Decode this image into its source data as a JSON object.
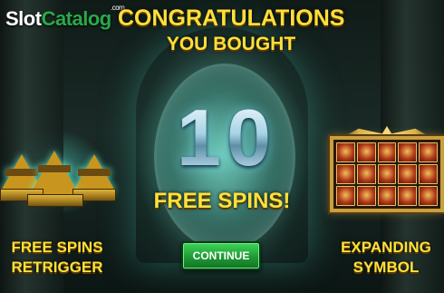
{
  "logo": {
    "slot": "Slot",
    "catalog": "Catalog",
    "com": ".com"
  },
  "headline": {
    "line1": "CONGRATULATIONS",
    "line2": "YOU BOUGHT"
  },
  "award": {
    "count": "10",
    "label": "FREE SPINS!"
  },
  "continue_button": {
    "label": "CONTINUE"
  },
  "features": {
    "left": {
      "line1": "FREE SPINS",
      "line2": "RETRIGGER",
      "icon": "pyramids-icon"
    },
    "right": {
      "line1": "EXPANDING",
      "line2": "SYMBOL",
      "icon": "reel-grid-icon"
    }
  },
  "colors": {
    "title_gold": "#ffdf3a",
    "button_green": "#1e9a34",
    "logo_green": "#2aa84a",
    "glow_teal": "#78ffe6"
  }
}
